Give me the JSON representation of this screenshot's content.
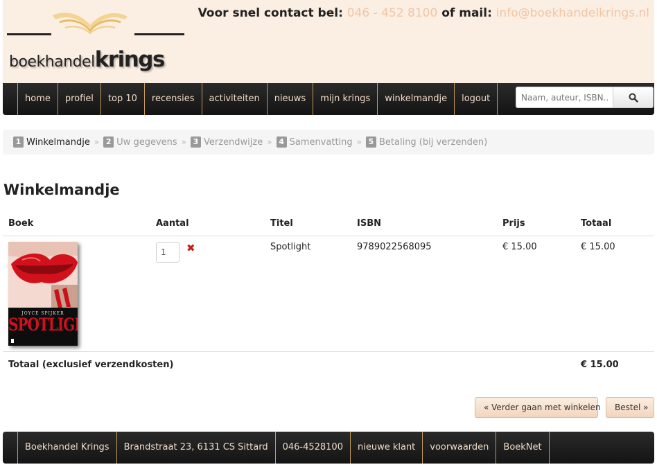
{
  "header": {
    "logo_text_light": "boekhandel",
    "logo_text_bold": "krings",
    "contact_prefix": "Voor snel contact bel:",
    "phone": "046 - 452 8100",
    "contact_middle": "of mail:",
    "email": "info@boekhandelkrings.nl"
  },
  "nav": {
    "items": [
      {
        "label": "home"
      },
      {
        "label": "profiel"
      },
      {
        "label": "top 10"
      },
      {
        "label": "recensies"
      },
      {
        "label": "activiteiten"
      },
      {
        "label": "nieuws"
      },
      {
        "label": "mijn krings"
      },
      {
        "label": "winkelmandje"
      },
      {
        "label": "logout"
      }
    ],
    "search_placeholder": "Naam, auteur, ISBN...",
    "search_icon": "search-icon"
  },
  "steps": [
    {
      "num": "1",
      "label": "Winkelmandje"
    },
    {
      "num": "2",
      "label": "Uw gegevens"
    },
    {
      "num": "3",
      "label": "Verzendwijze"
    },
    {
      "num": "4",
      "label": "Samenvatting"
    },
    {
      "num": "5",
      "label": "Betaling (bij verzenden)"
    }
  ],
  "step_separator": "»",
  "page_title": "Winkelmandje",
  "cart": {
    "headers": {
      "book": "Boek",
      "quantity": "Aantal",
      "title": "Titel",
      "isbn": "ISBN",
      "price": "Prijs",
      "total": "Totaal"
    },
    "items": [
      {
        "cover_author": "JOYCE SPIJKER",
        "cover_title": "SPOTLIGHT",
        "quantity": "1",
        "remove_icon": "close-icon",
        "title": "Spotlight",
        "isbn": "9789022568095",
        "price": "€ 15.00",
        "total": "€ 15.00"
      }
    ],
    "total_label": "Totaal (exclusief verzendkosten)",
    "total_value": "€ 15.00"
  },
  "buttons": {
    "continue_label": "« Verder gaan met winkelen",
    "order_label": "Bestel »"
  },
  "footer": {
    "items": [
      {
        "label": "Boekhandel Krings"
      },
      {
        "label": "Brandstraat 23, 6131 CS Sittard"
      },
      {
        "label": "046-4528100"
      },
      {
        "label": "nieuwe klant"
      },
      {
        "label": "voorwaarden"
      },
      {
        "label": "BoekNet"
      }
    ]
  },
  "colors": {
    "accent": "#f2c6a3",
    "header_bg": "#fbeee2",
    "nav_bg": "#1e1e1e",
    "nav_text": "#f0dcc6",
    "remove": "#c0201a"
  }
}
